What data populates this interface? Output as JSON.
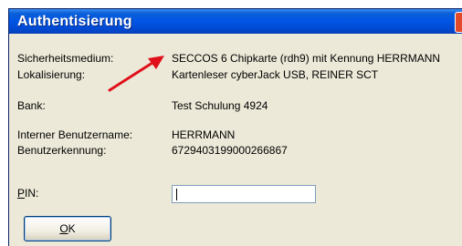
{
  "window": {
    "title": "Authentisierung"
  },
  "fields": {
    "security_medium_label": "Sicherheitsmedium:",
    "security_medium_value": "SECCOS 6 Chipkarte (rdh9) mit Kennung HERRMANN",
    "localization_label": "Lokalisierung:",
    "localization_value": "Kartenleser cyberJack USB, REINER SCT",
    "bank_label": "Bank:",
    "bank_value": "Test Schulung 4924",
    "internal_user_label": "Interner Benutzername:",
    "internal_user_value": "HERRMANN",
    "user_id_label": "Benutzerkennung:",
    "user_id_value": "6729403199000266867"
  },
  "pin": {
    "label_accesskey": "P",
    "label_rest": "IN:",
    "value": ""
  },
  "buttons": {
    "ok_accesskey": "O",
    "ok_rest": "K"
  },
  "icons": {
    "annotation": "red-arrow-icon",
    "close": "close-icon"
  },
  "colors": {
    "titlebar": "#0055e5",
    "dialog_background": "#ece9d8",
    "annotation_arrow": "#e0101a"
  }
}
